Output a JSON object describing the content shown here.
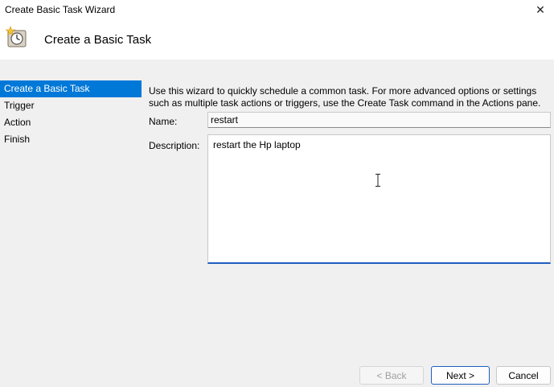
{
  "window": {
    "title": "Create Basic Task Wizard",
    "close_glyph": "✕"
  },
  "header": {
    "title": "Create a Basic Task",
    "icon": "task-clock-icon"
  },
  "nav": {
    "items": [
      {
        "label": "Create a Basic Task",
        "active": true
      },
      {
        "label": "Trigger",
        "active": false
      },
      {
        "label": "Action",
        "active": false
      },
      {
        "label": "Finish",
        "active": false
      }
    ]
  },
  "content": {
    "intro": "Use this wizard to quickly schedule a common task.  For more advanced options or settings such as multiple task actions or triggers, use the Create Task command in the Actions pane.",
    "name_label": "Name:",
    "name_value": "restart",
    "description_label": "Description:",
    "description_value": "restart the Hp laptop"
  },
  "footer": {
    "back_label": "< Back",
    "next_label": "Next >",
    "cancel_label": "Cancel"
  },
  "colors": {
    "accent": "#0078d7",
    "focus_border": "#1f5fbf"
  }
}
